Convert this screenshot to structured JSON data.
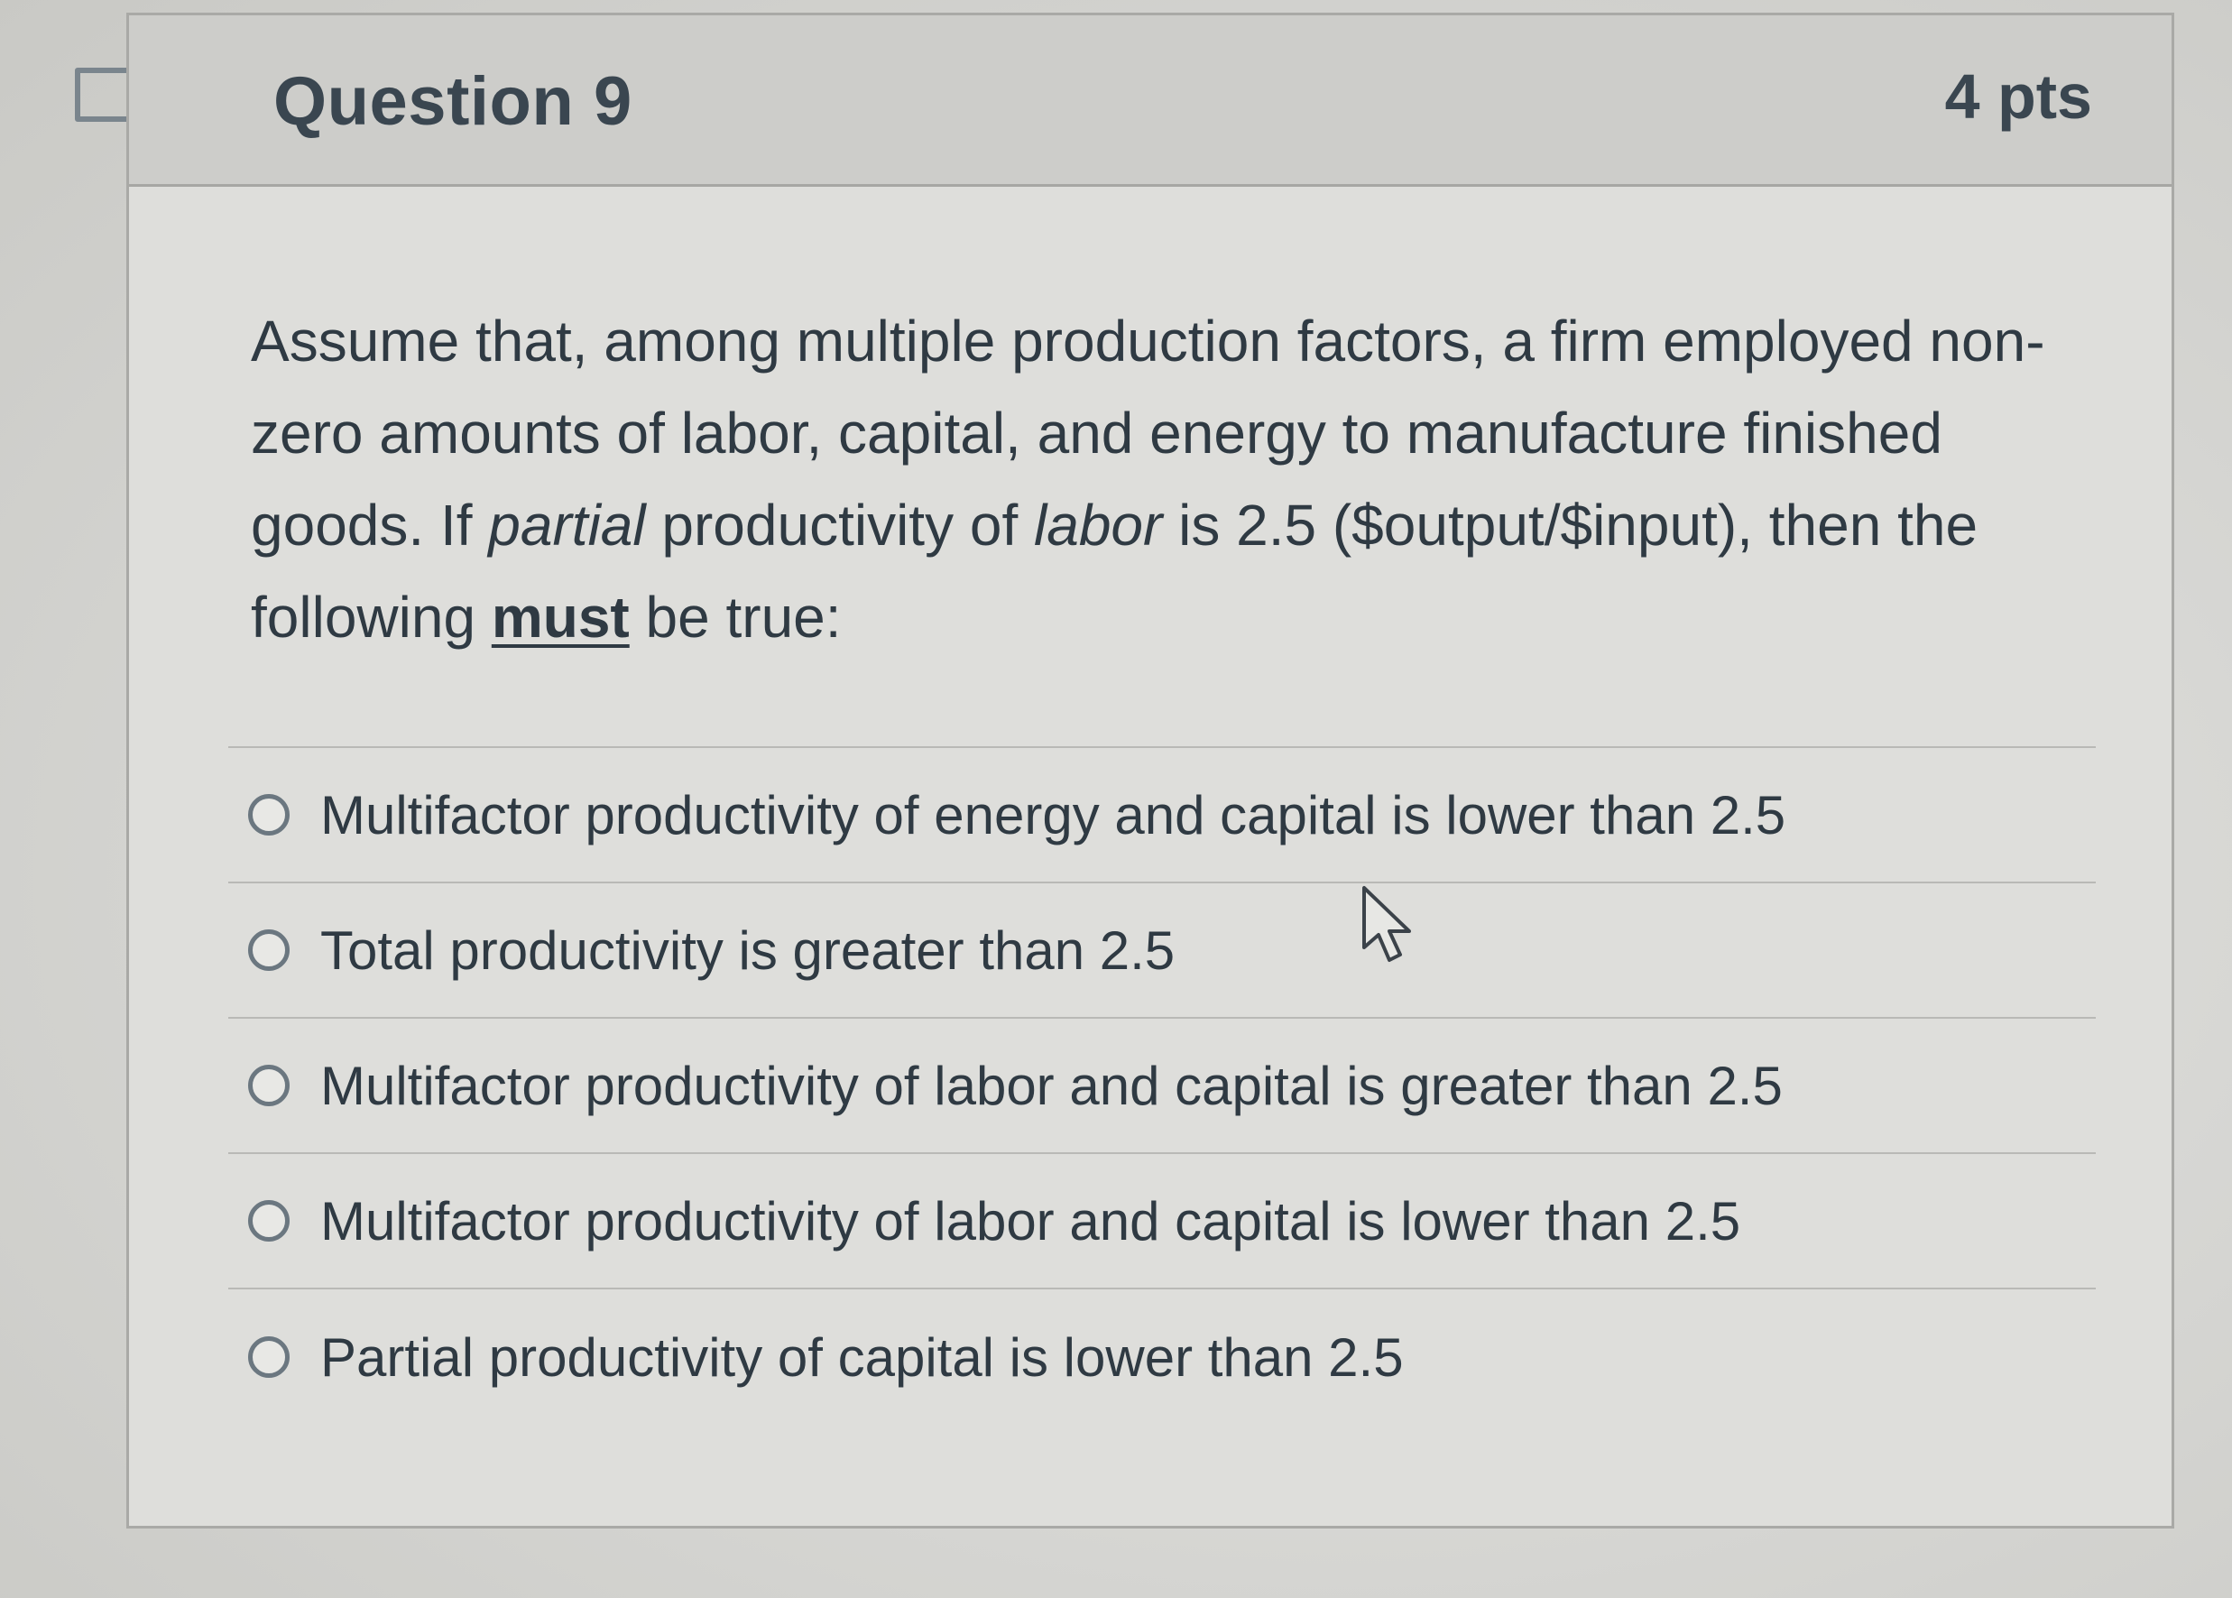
{
  "question": {
    "title": "Question 9",
    "points": "4 pts",
    "text_parts": {
      "p1": "Assume that, among multiple production factors, a firm employed non-zero amounts of labor, capital, and energy to manufacture finished goods. If ",
      "italic1": "partial",
      "p2": " productivity of ",
      "italic2": "labor",
      "p3": " is 2.5 ($output/$input), then the following ",
      "bold_underline": "must",
      "p4": " be true:"
    }
  },
  "answers": [
    {
      "label": "Multifactor productivity of energy and capital is lower than 2.5",
      "selected": false
    },
    {
      "label": "Total productivity is greater than 2.5",
      "selected": false
    },
    {
      "label": "Multifactor productivity of labor and capital is greater than 2.5",
      "selected": false
    },
    {
      "label": "Multifactor productivity of labor and capital is lower than 2.5",
      "selected": false
    },
    {
      "label": "Partial productivity of capital is lower than 2.5",
      "selected": false
    }
  ],
  "icons": {
    "flag": "flag-icon",
    "cursor": "mouse-pointer-icon",
    "radio": "radio-button-icon"
  },
  "colors": {
    "text": "#2f3a43",
    "header_bg": "#cdcdca",
    "body_bg": "#dededb",
    "border": "#a9a9a6"
  }
}
